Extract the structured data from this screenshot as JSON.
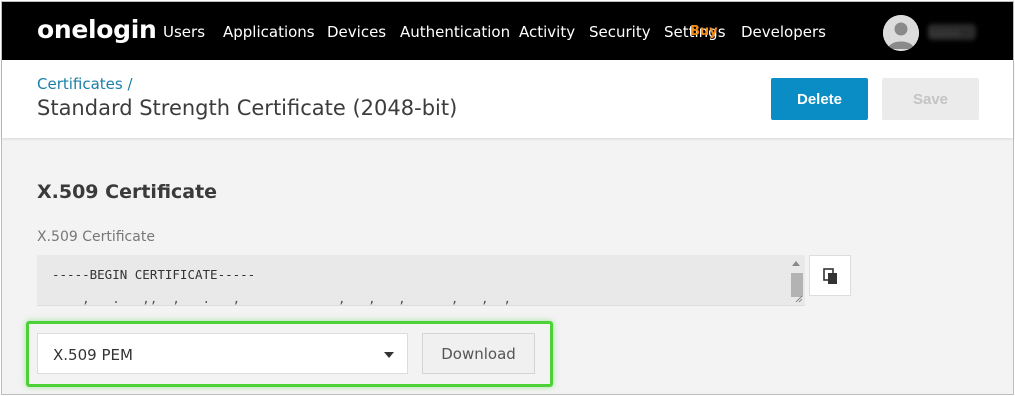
{
  "nav": {
    "logo": "onelogin",
    "items": [
      "Users",
      "Applications",
      "Devices",
      "Authentication",
      "Activity",
      "Security",
      "Settings",
      "Developers"
    ],
    "settings_badge": "Buy",
    "user_name": "Name"
  },
  "header": {
    "breadcrumb": "Certificates /",
    "title": "Standard Strength Certificate (2048-bit)",
    "delete_label": "Delete",
    "save_label": "Save"
  },
  "certificate": {
    "section_title": "X.509 Certificate",
    "field_label": "X.509 Certificate",
    "text_line1": "-----BEGIN CERTIFICATE-----",
    "text_line2": "    ,   .   ,,  ,   .   ,             ,   ,   ,      ,   ,  ,",
    "copy_icon": "copy-icon"
  },
  "download": {
    "format_selected": "X.509 PEM",
    "download_label": "Download"
  },
  "colors": {
    "nav_bg": "#000000",
    "link": "#1a7fa8",
    "primary_button": "#0a8cc4",
    "highlight": "#4cd137",
    "badge": "#f28c18"
  }
}
